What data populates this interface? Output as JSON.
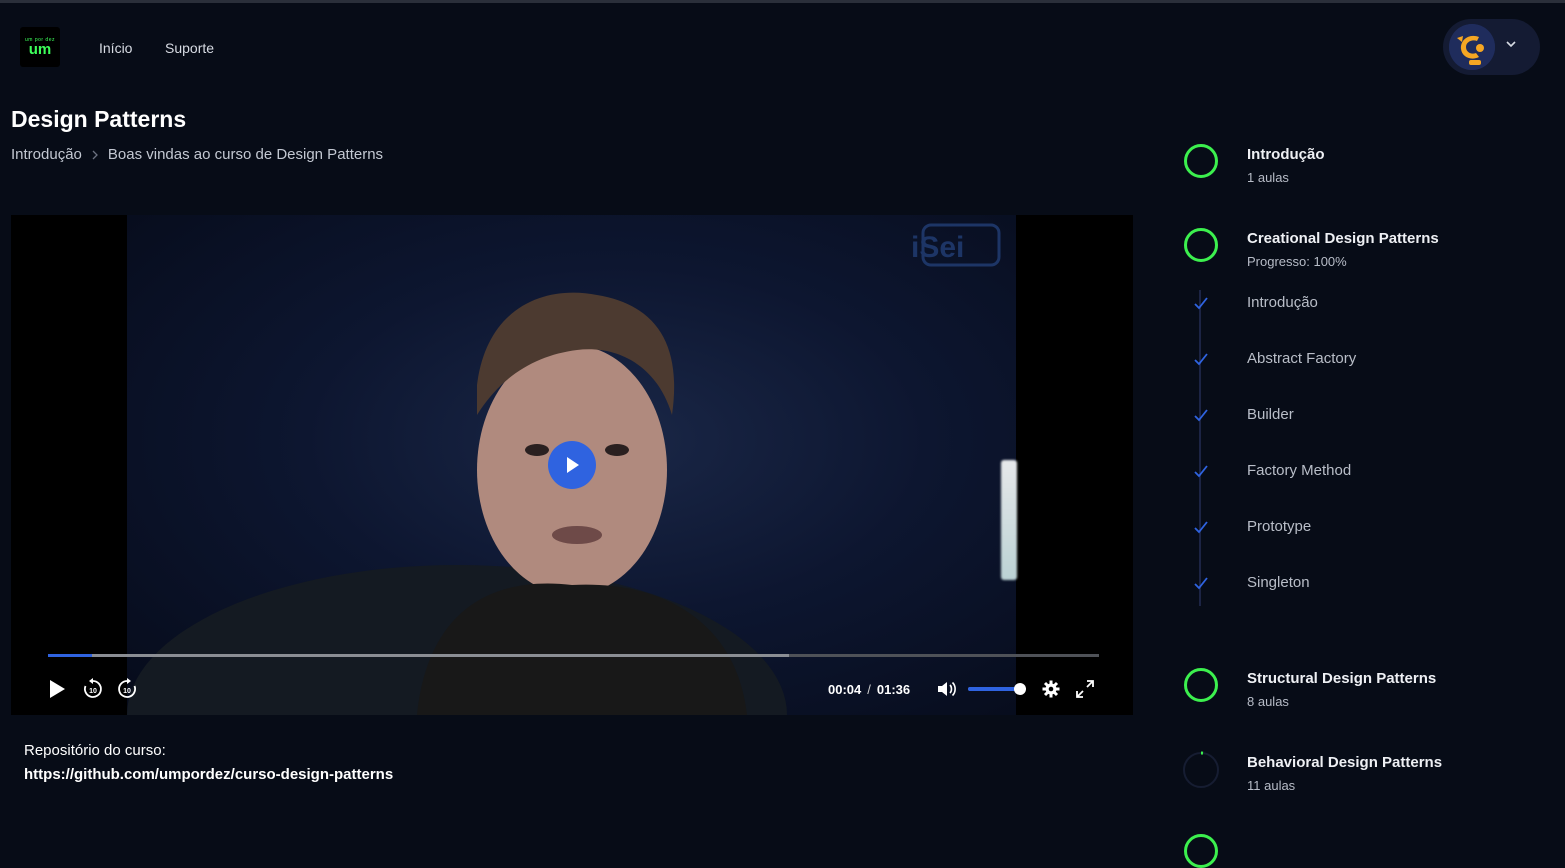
{
  "header": {
    "logo_small": "um por dez",
    "logo_big": "um",
    "nav": {
      "inicio": "Início",
      "suporte": "Suporte"
    }
  },
  "page": {
    "title": "Design Patterns",
    "breadcrumb": {
      "section": "Introdução",
      "lesson": "Boas vindas ao curso de Design Patterns"
    }
  },
  "player": {
    "watermark": "iSei",
    "current_time": "00:04",
    "separator": "/",
    "duration": "01:36",
    "played_fraction": 0.042,
    "buffered_fraction": 0.705,
    "volume_fraction": 0.9,
    "skip_seconds": "10",
    "accent_color": "#2f63e0"
  },
  "description": {
    "repo_label": "Repositório do curso:",
    "repo_url": "https://github.com/umpordez/curso-design-patterns"
  },
  "sidebar": {
    "complete_color": "#3cf04e",
    "modules": [
      {
        "title": "Introdução",
        "subtitle": "1 aulas",
        "status": "complete"
      },
      {
        "title": "Creational Design Patterns",
        "subtitle": "Progresso: 100%",
        "status": "complete",
        "lessons": [
          "Introdução",
          "Abstract Factory",
          "Builder",
          "Factory Method",
          "Prototype",
          "Singleton"
        ]
      },
      {
        "title": "Structural Design Patterns",
        "subtitle": "8 aulas",
        "status": "complete"
      },
      {
        "title": "Behavioral Design Patterns",
        "subtitle": "11 aulas",
        "status": "pending"
      }
    ]
  }
}
